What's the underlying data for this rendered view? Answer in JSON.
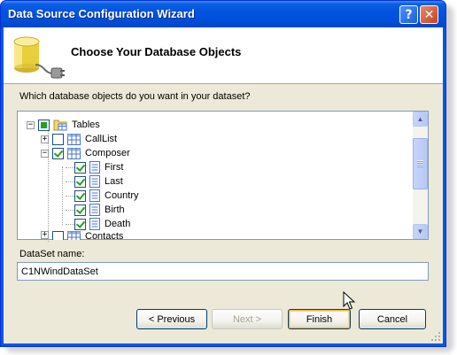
{
  "window": {
    "title": "Data Source Configuration Wizard",
    "help_label": "?",
    "close_label": "✕"
  },
  "header": {
    "title": "Choose Your Database Objects",
    "icon": "database-plug-icon"
  },
  "question": "Which database objects do you want in your dataset?",
  "tree": {
    "root": {
      "label": "Tables",
      "expander": "−",
      "state": "partial"
    },
    "items": [
      {
        "label": "CallList",
        "expander": "+",
        "checked": false,
        "kind": "table"
      },
      {
        "label": "Composer",
        "expander": "−",
        "checked": true,
        "kind": "table"
      },
      {
        "label": "First",
        "checked": true,
        "kind": "field"
      },
      {
        "label": "Last",
        "checked": true,
        "kind": "field"
      },
      {
        "label": "Country",
        "checked": true,
        "kind": "field"
      },
      {
        "label": "Birth",
        "checked": true,
        "kind": "field"
      },
      {
        "label": "Death",
        "checked": true,
        "kind": "field"
      },
      {
        "label": "Contacts",
        "expander": "+",
        "checked": false,
        "kind": "table"
      }
    ]
  },
  "dataset": {
    "label": "DataSet name:",
    "value": "C1NWindDataSet"
  },
  "buttons": {
    "previous": "< Previous",
    "next": "Next >",
    "finish": "Finish",
    "cancel": "Cancel"
  },
  "colors": {
    "titlebar": "#0054e3",
    "client_bg": "#ece9d8",
    "check_green": "#21a121"
  }
}
